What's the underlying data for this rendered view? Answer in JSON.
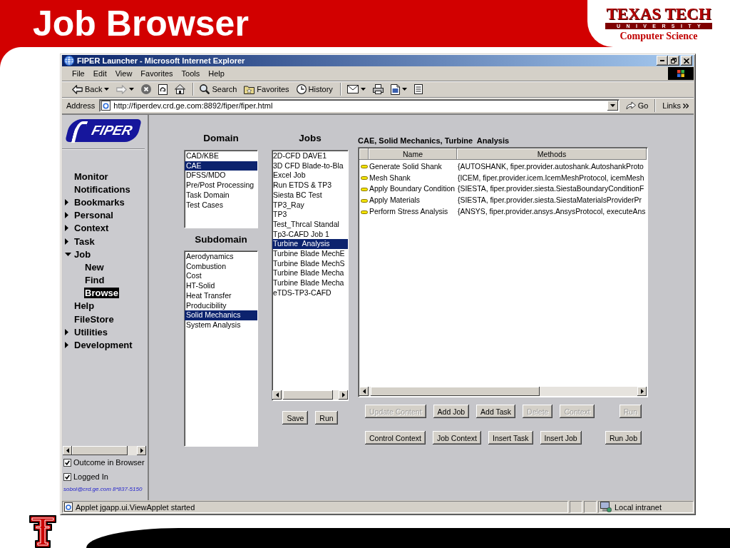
{
  "slide": {
    "title": "Job Browser",
    "logo": {
      "wordmark": "TEXAS TECH",
      "band": "UNIVERSITY",
      "department": "Computer Science"
    }
  },
  "window": {
    "title": "FIPER Launcher - Microsoft Internet Explorer"
  },
  "menu_bar": [
    "File",
    "Edit",
    "View",
    "Favorites",
    "Tools",
    "Help"
  ],
  "toolbar": [
    [
      {
        "kind": "back",
        "label": "Back",
        "dropdown": true,
        "disabled": false
      },
      {
        "kind": "forward",
        "dropdown": true,
        "disabled": true
      },
      {
        "kind": "stop",
        "dropdown": false,
        "disabled": false
      },
      {
        "kind": "refresh",
        "dropdown": false,
        "disabled": false
      },
      {
        "kind": "home",
        "dropdown": false,
        "disabled": false
      }
    ],
    [
      {
        "kind": "search",
        "label": "Search",
        "dropdown": false,
        "disabled": false
      },
      {
        "kind": "favorites",
        "label": "Favorites",
        "dropdown": false,
        "disabled": false
      },
      {
        "kind": "history",
        "label": "History",
        "dropdown": false,
        "disabled": false
      }
    ],
    [
      {
        "kind": "mail",
        "dropdown": true,
        "disabled": false
      },
      {
        "kind": "print",
        "dropdown": false,
        "disabled": false
      },
      {
        "kind": "edit",
        "dropdown": true,
        "disabled": false
      },
      {
        "kind": "discuss",
        "dropdown": false,
        "disabled": false
      }
    ]
  ],
  "address_bar": {
    "label": "Address",
    "value": "http://fiperdev.crd.ge.com:8892/fiper/fiper.html",
    "go": "Go",
    "links": "Links"
  },
  "sidebar": {
    "logo": "FIPER",
    "items": [
      {
        "label": "Monitor",
        "kind": "link",
        "selected": false
      },
      {
        "label": "Notifications",
        "kind": "link",
        "selected": false
      },
      {
        "label": "Bookmarks",
        "kind": "folder",
        "expanded": false,
        "selected": false
      },
      {
        "label": "Personal",
        "kind": "folder",
        "expanded": false,
        "selected": false
      },
      {
        "label": "Context",
        "kind": "folder",
        "expanded": false,
        "selected": false
      },
      {
        "label": "Task",
        "kind": "folder",
        "expanded": false,
        "selected": false
      },
      {
        "label": "Job",
        "kind": "folder",
        "expanded": true,
        "selected": false,
        "children": [
          {
            "label": "New",
            "selected": false
          },
          {
            "label": "Find",
            "selected": false
          },
          {
            "label": "Browse",
            "selected": true
          }
        ]
      },
      {
        "label": "Help",
        "kind": "link",
        "selected": false
      },
      {
        "label": "FileStore",
        "kind": "link",
        "selected": false
      },
      {
        "label": "Utilities",
        "kind": "folder",
        "expanded": false,
        "selected": false
      },
      {
        "label": "Development",
        "kind": "folder",
        "expanded": false,
        "selected": false
      }
    ],
    "options": [
      {
        "label": "Outcome in Browser",
        "checked": true
      },
      {
        "label": "Logged In",
        "checked": true
      }
    ],
    "contact": "sobol@crd.ge.com 8*837-5150"
  },
  "domain": {
    "heading": "Domain",
    "items": [
      {
        "label": "CAD/KBE",
        "selected": false
      },
      {
        "label": "CAE",
        "selected": true
      },
      {
        "label": "DFSS/MDO",
        "selected": false
      },
      {
        "label": "Pre/Post Processing",
        "selected": false
      },
      {
        "label": "Task Domain",
        "selected": false
      },
      {
        "label": "Test Cases",
        "selected": false
      }
    ]
  },
  "subdomain": {
    "heading": "Subdomain",
    "items": [
      {
        "label": "Aerodynamics",
        "selected": false
      },
      {
        "label": "Combustion",
        "selected": false
      },
      {
        "label": "Cost",
        "selected": false
      },
      {
        "label": "HT-Solid",
        "selected": false
      },
      {
        "label": "Heat Transfer",
        "selected": false
      },
      {
        "label": "Producibility",
        "selected": false
      },
      {
        "label": "Solid Mechanics",
        "selected": true
      },
      {
        "label": "System Analysis",
        "selected": false
      }
    ]
  },
  "jobs": {
    "heading": "Jobs",
    "items": [
      {
        "label": "2D-CFD DAVE1",
        "selected": false
      },
      {
        "label": "3D CFD Blade-to-Bla",
        "selected": false
      },
      {
        "label": "Excel Job",
        "selected": false
      },
      {
        "label": "Run ETDS & TP3",
        "selected": false
      },
      {
        "label": "Siesta BC Test",
        "selected": false
      },
      {
        "label": "TP3_Ray",
        "selected": false
      },
      {
        "label": "TP3",
        "selected": false
      },
      {
        "label": "Test_Thrcal Standal",
        "selected": false
      },
      {
        "label": "Tp3-CAFD Job 1",
        "selected": false
      },
      {
        "label": "Turbine  Analysis",
        "selected": true
      },
      {
        "label": "Turbine Blade MechE",
        "selected": false
      },
      {
        "label": "Turbine Blade MechS",
        "selected": false
      },
      {
        "label": "Turbine Blade Mecha",
        "selected": false
      },
      {
        "label": "Turbine Blade Mecha",
        "selected": false
      },
      {
        "label": "eTDS-TP3-CAFD",
        "selected": false
      }
    ],
    "buttons": [
      "Save",
      "Run"
    ]
  },
  "task_panel": {
    "title": "CAE, Solid Mechanics, Turbine  Analysis",
    "table": {
      "columns": [
        "Name",
        "Methods"
      ],
      "rows": [
        {
          "name": "Generate Solid Shank",
          "methods": "{AUTOSHANK, fiper.provider.autoshank.AutoshankProto"
        },
        {
          "name": "Mesh Shank",
          "methods": "{ICEM, fiper.provider.icem.IcemMeshProtocol, icemMesh"
        },
        {
          "name": "Apply Boundary Condition",
          "methods": "{SIESTA, fiper.provider.siesta.SiestaBoundaryConditionF"
        },
        {
          "name": "Apply Materials",
          "methods": "{SIESTA, fiper.provider.siesta.SiestaMaterialsProviderPr"
        },
        {
          "name": "Perform Stress Analysis",
          "methods": "{ANSYS, fiper.provider.ansys.AnsysProtocol, executeAns"
        }
      ]
    },
    "button_rows": [
      [
        {
          "label": "Update Content",
          "disabled": true
        },
        {
          "label": "Add Job",
          "disabled": false
        },
        {
          "label": "Add Task",
          "disabled": false
        },
        {
          "label": "Delete",
          "disabled": true
        },
        {
          "label": "Context",
          "disabled": true
        },
        {
          "label": "Run",
          "disabled": true
        }
      ],
      [
        {
          "label": "Control Context",
          "disabled": false
        },
        {
          "label": "Job Context",
          "disabled": false
        },
        {
          "label": "Insert Task",
          "disabled": false
        },
        {
          "label": "Insert Job",
          "disabled": false
        },
        {
          "label": "Run Job",
          "disabled": false
        }
      ]
    ]
  },
  "status_bar": {
    "text": "Applet jgapp.ui.ViewApplet started",
    "zone": "Local intranet"
  }
}
